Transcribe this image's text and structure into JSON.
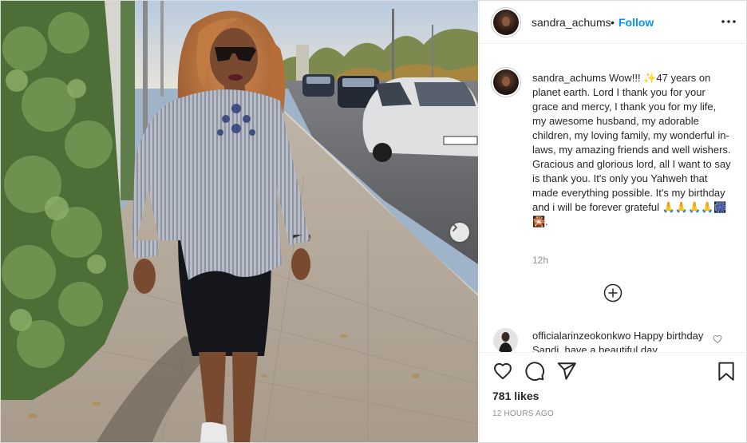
{
  "post": {
    "username": "sandra_achums",
    "separator": "•",
    "follow_label": "Follow",
    "more_icon": "more-dots-icon",
    "caption_text": "Wow!!! ✨47 years on planet earth. Lord I thank you for your grace and mercy, I thank you for my life, my awesome husband, my adorable children, my loving family, my wonderful in-laws, my amazing friends and well wishers. Gracious and glorious lord, all I want to say is thank you. It's only you Yahweh that made everything possible. It's my birthday and i will be forever grateful 🙏🙏🙏🙏🎆🎇.",
    "caption_time": "12h",
    "load_more_icon": "plus-circle-icon",
    "likes": "781 likes",
    "time_ago": "12 HOURS AGO"
  },
  "comments": [
    {
      "username": "officialarinzeokonkwo",
      "text": "Happy birthday Sandi, have a beautiful day..."
    }
  ],
  "actions": {
    "like_icon": "heart-icon",
    "comment_icon": "comment-icon",
    "share_icon": "share-icon",
    "save_icon": "bookmark-icon"
  },
  "colors": {
    "accent": "#0095f6",
    "text": "#262626",
    "muted": "#8e8e8e",
    "divider": "#efefef"
  }
}
